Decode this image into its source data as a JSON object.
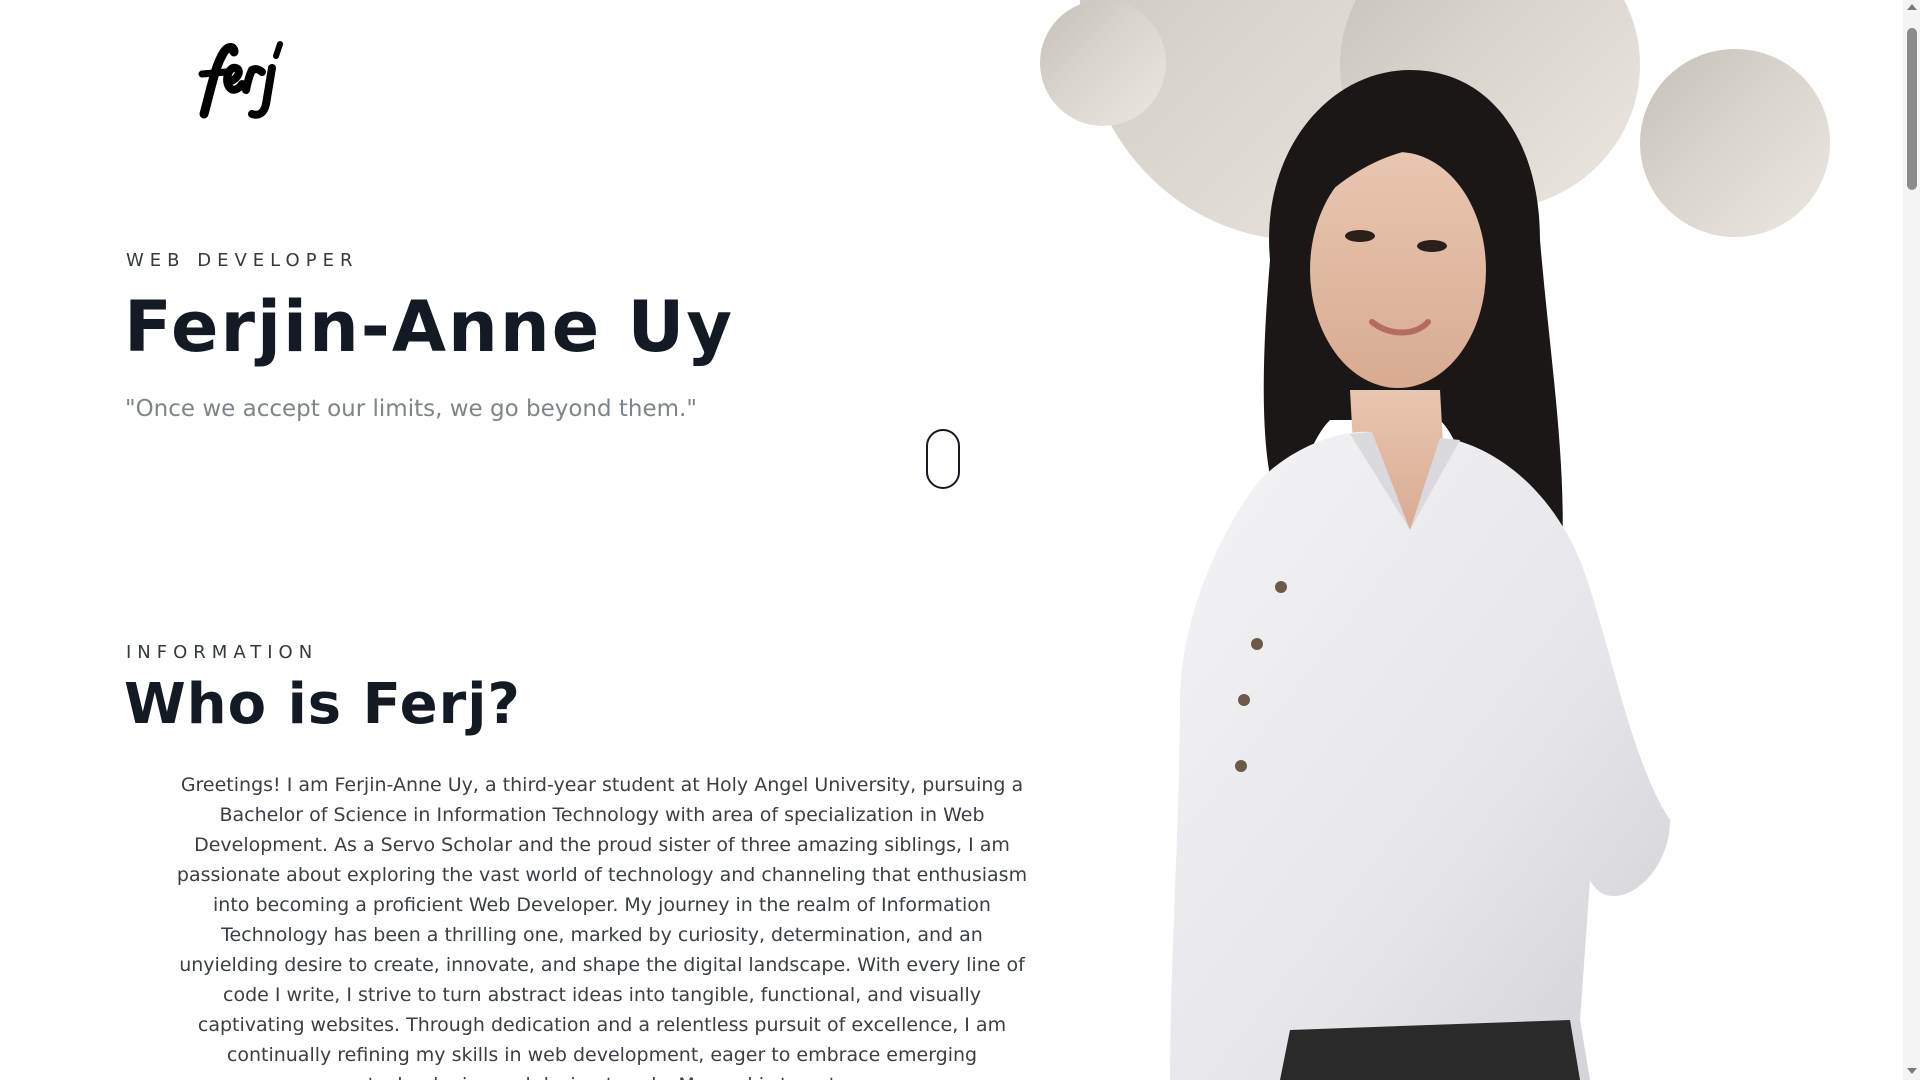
{
  "header": {
    "logo_text": "ferj"
  },
  "hero": {
    "role": "WEB DEVELOPER",
    "name": "Ferjin-Anne Uy",
    "quote": "\"Once we accept our limits, we go beyond them.\""
  },
  "info": {
    "label": "INFORMATION",
    "title": "Who is Ferj?",
    "bio": "Greetings! I am Ferjin-Anne Uy, a third-year student at Holy Angel University, pursuing a Bachelor of Science in Information Technology with area of specialization in Web Development. As a Servo Scholar and the proud sister of three amazing siblings, I am passionate about exploring the vast world of technology and channeling that enthusiasm into becoming a proficient Web Developer. My journey in the realm of Information Technology has been a thrilling one, marked by curiosity, determination, and an unyielding desire to create, innovate, and shape the digital landscape. With every line of code I write, I strive to turn abstract ideas into tangible, functional, and visually captivating websites. Through dedication and a relentless pursuit of excellence, I am continually refining my skills in web development, eager to embrace emerging technologies and design trends. My goal is to not"
  },
  "colors": {
    "heading": "#141a24",
    "quote": "#7d848c",
    "circle_light": "#ece8e1",
    "circle_dark": "#c4c0b9"
  },
  "icons": {
    "scroll_indicator": "mouse-scroll-icon"
  }
}
